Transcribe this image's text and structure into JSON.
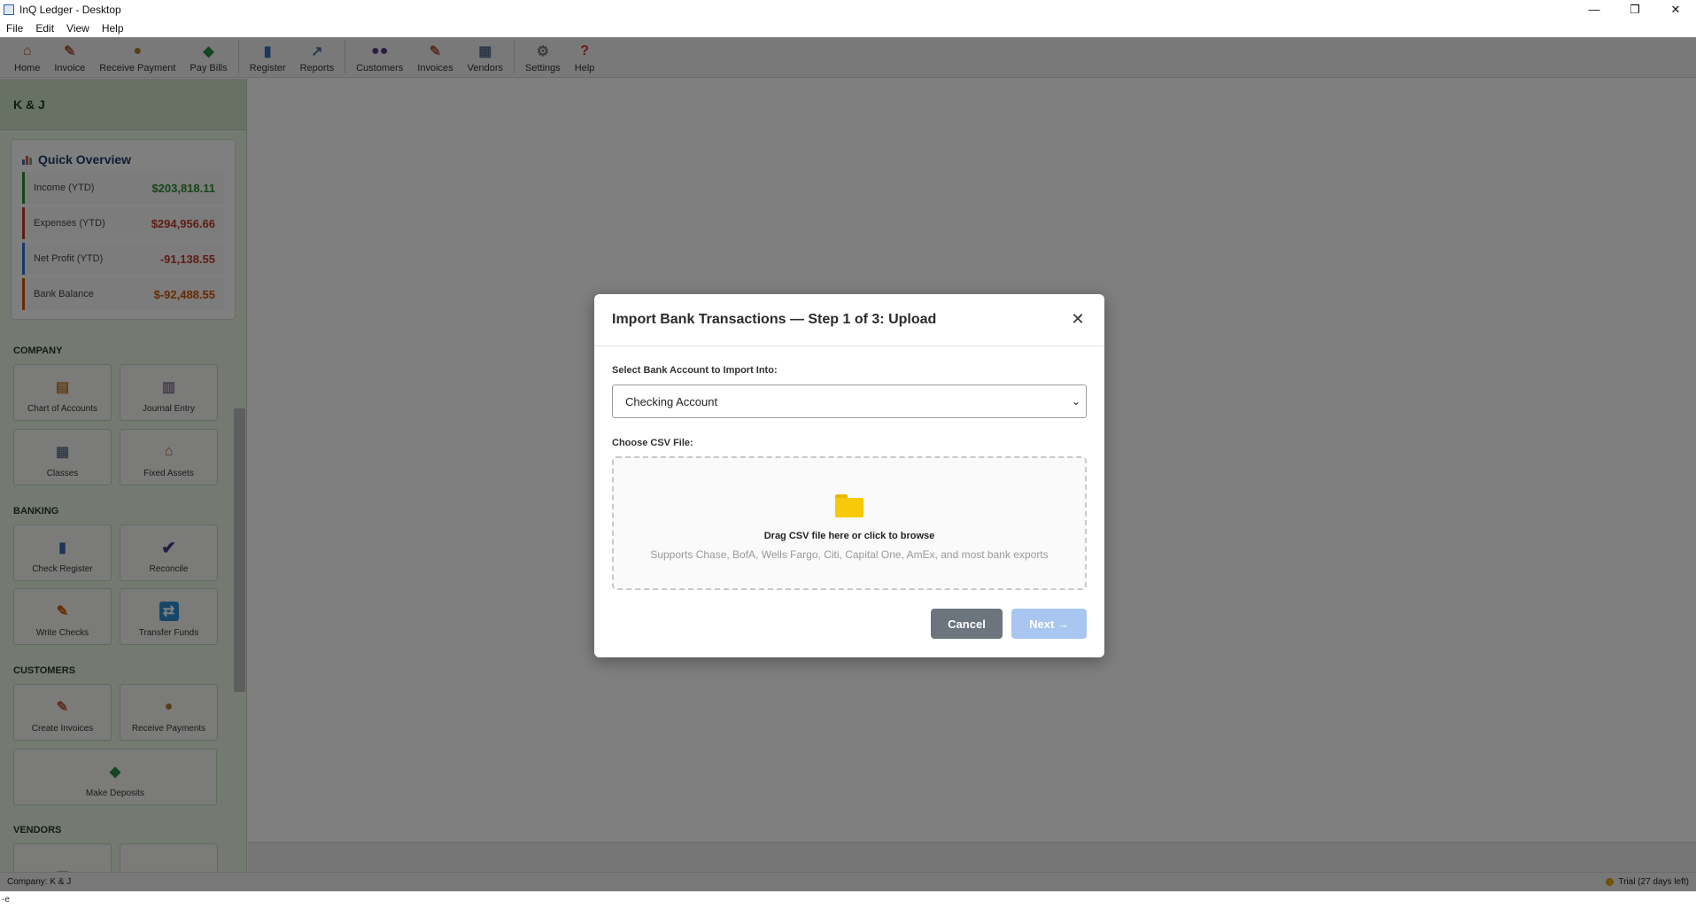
{
  "window": {
    "title": "InQ Ledger - Desktop",
    "minimize": "—",
    "maximize": "❐",
    "close": "✕"
  },
  "menu": [
    "File",
    "Edit",
    "View",
    "Help"
  ],
  "toolbar": [
    {
      "label": "Home",
      "icon": "home-icon",
      "glyph": "⌂",
      "color": "#c0552f"
    },
    {
      "label": "Invoice",
      "icon": "invoice-icon",
      "glyph": "✎",
      "color": "#b85a40"
    },
    {
      "label": "Receive Payment",
      "icon": "money-bag-icon",
      "glyph": "●",
      "color": "#b07a2a"
    },
    {
      "label": "Pay Bills",
      "icon": "cash-icon",
      "glyph": "◆",
      "color": "#2e8b3e"
    },
    {
      "label": "Register",
      "icon": "register-icon",
      "glyph": "▮",
      "color": "#3a6fb5"
    },
    {
      "label": "Reports",
      "icon": "reports-icon",
      "glyph": "↗",
      "color": "#4a6fa0"
    },
    {
      "label": "Customers",
      "icon": "customers-icon",
      "glyph": "●●",
      "color": "#5b3d80"
    },
    {
      "label": "Invoices",
      "icon": "invoices-icon",
      "glyph": "✎",
      "color": "#b85a40"
    },
    {
      "label": "Vendors",
      "icon": "vendors-icon",
      "glyph": "▦",
      "color": "#5a6f8a"
    },
    {
      "label": "Settings",
      "icon": "gear-icon",
      "glyph": "⚙",
      "color": "#777777"
    },
    {
      "label": "Help",
      "icon": "help-icon",
      "glyph": "?",
      "color": "#d32f2f"
    }
  ],
  "sidebar": {
    "company": "K & J",
    "overview": {
      "title": "Quick Overview",
      "stats": [
        {
          "label": "Income (YTD)",
          "value": "$203,818.11",
          "color": "#2f8a2f"
        },
        {
          "label": "Expenses (YTD)",
          "value": "$294,956.66",
          "color": "#c0392b"
        },
        {
          "label": "Net Profit (YTD)",
          "value": "-91,138.55",
          "color": "#c0392b",
          "border": "#2e6fd1"
        },
        {
          "label": "Bank Balance",
          "value": "$-92,488.55",
          "color": "#d35400",
          "border": "#d35400"
        }
      ]
    },
    "sections": {
      "company": "COMPANY",
      "banking": "BANKING",
      "customers": "CUSTOMERS",
      "vendors": "VENDORS"
    },
    "tiles": {
      "chart_of_accounts": "Chart of Accounts",
      "journal_entry": "Journal Entry",
      "classes": "Classes",
      "fixed_assets": "Fixed Assets",
      "check_register": "Check Register",
      "reconcile": "Reconcile",
      "write_checks": "Write Checks",
      "transfer_funds": "Transfer Funds",
      "create_invoices": "Create Invoices",
      "receive_payments": "Receive Payments",
      "make_deposits": "Make Deposits"
    }
  },
  "statusbar": {
    "company": "Company: K & J",
    "trial": "Trial (27 days left)"
  },
  "bottom_text": "-e",
  "modal": {
    "title": "Import Bank Transactions — Step 1 of 3: Upload",
    "close": "✕",
    "account_label": "Select Bank Account to Import Into:",
    "account_value": "Checking Account",
    "file_label": "Choose CSV File:",
    "drop_main": "Drag CSV file here or click to browse",
    "drop_sub": "Supports Chase, BofA, Wells Fargo, Citi, Capital One, AmEx, and most bank exports",
    "cancel": "Cancel",
    "next": "Next →"
  }
}
